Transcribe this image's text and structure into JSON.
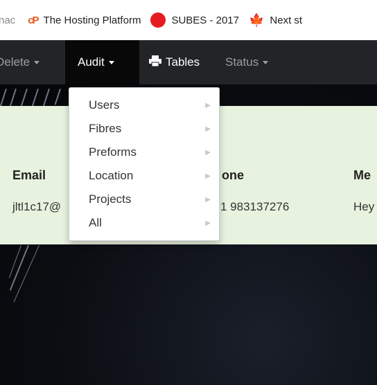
{
  "bookmarks": [
    {
      "label": "nac",
      "icon": "",
      "partial": true
    },
    {
      "label": "The Hosting Platform",
      "icon": "cp-logo-icon"
    },
    {
      "label": "SUBES - 2017",
      "icon": "red-circle-icon"
    },
    {
      "label": "Next st",
      "icon": "maple-leaf-icon"
    }
  ],
  "navbar": {
    "delete_label": "Delete",
    "audit_label": "Audit",
    "tables_label": "Tables",
    "status_label": "Status"
  },
  "table": {
    "headers": [
      "Email",
      "one",
      "Me"
    ],
    "row": [
      "jltl1c17@",
      "1 983137276",
      "Hey"
    ]
  },
  "dropdown": {
    "items": [
      "Users",
      "Fibres",
      "Preforms",
      "Location",
      "Projects",
      "All"
    ]
  }
}
